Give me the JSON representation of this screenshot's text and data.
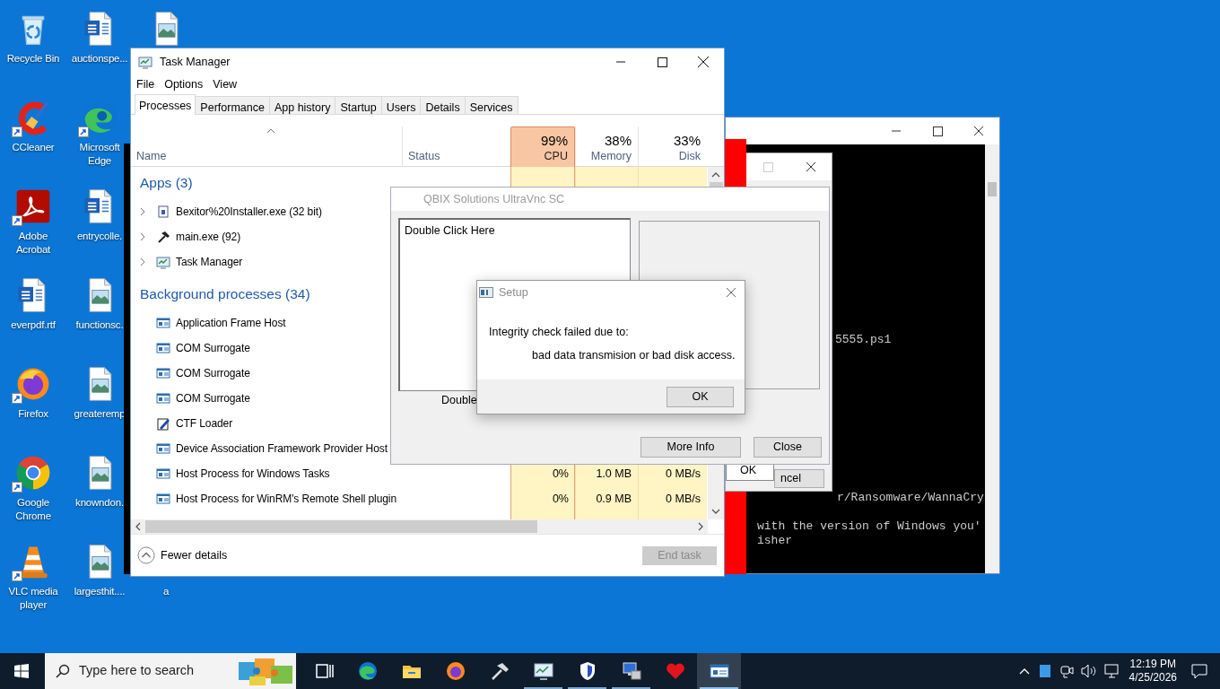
{
  "desktop_icons": [
    {
      "label": "Recycle Bin",
      "kind": "recycle",
      "shortcut": false
    },
    {
      "label": "CCleaner",
      "kind": "ccleaner",
      "shortcut": true
    },
    {
      "label": "Adobe Acrobat",
      "kind": "acrobat",
      "shortcut": true
    },
    {
      "label": "everpdf.rtf",
      "kind": "word",
      "shortcut": false
    },
    {
      "label": "Firefox",
      "kind": "firefox",
      "shortcut": true
    },
    {
      "label": "Google Chrome",
      "kind": "chrome",
      "shortcut": true
    },
    {
      "label": "VLC media player",
      "kind": "vlc",
      "shortcut": true
    },
    {
      "label": "auctionspe...",
      "kind": "word",
      "shortcut": false
    },
    {
      "label": "Microsoft Edge",
      "kind": "edge",
      "shortcut": true
    },
    {
      "label": "entrycolle.",
      "kind": "word",
      "shortcut": false
    },
    {
      "label": "functionsc.",
      "kind": "image",
      "shortcut": false
    },
    {
      "label": "greateremp",
      "kind": "image",
      "shortcut": false
    },
    {
      "label": "knowndon.",
      "kind": "image",
      "shortcut": false
    },
    {
      "label": "largesthit....",
      "kind": "image",
      "shortcut": false
    },
    {
      "kind": "image",
      "shortcut": false
    },
    {
      "label": "a"
    }
  ],
  "console": {
    "lines": [
      "5555.ps1",
      "r/Ransomware/WannaCry",
      "with the version of Windows you'",
      "isher"
    ]
  },
  "background_dialog": {
    "buttons": [
      "OK",
      "ncel"
    ]
  },
  "task_manager": {
    "title": "Task Manager",
    "menu": [
      "File",
      "Options",
      "View"
    ],
    "tabs": [
      {
        "label": "Processes",
        "selected": true
      },
      {
        "label": "Performance",
        "selected": false
      },
      {
        "label": "App history",
        "selected": false
      },
      {
        "label": "Startup",
        "selected": false
      },
      {
        "label": "Users",
        "selected": false
      },
      {
        "label": "Details",
        "selected": false
      },
      {
        "label": "Services",
        "selected": false
      }
    ],
    "columns": [
      {
        "label": "Name",
        "sorted": true,
        "highlighted": false
      },
      {
        "label": "Status",
        "sorted": false,
        "highlighted": false
      },
      {
        "label": "CPU",
        "total": "99%",
        "sorted": false,
        "highlighted": true
      },
      {
        "label": "Memory",
        "total": "38%",
        "sorted": false,
        "highlighted": false
      },
      {
        "label": "Disk",
        "total": "33%",
        "sorted": false,
        "highlighted": false
      }
    ],
    "groups": [
      {
        "title": "Apps (3)",
        "processes": [
          {
            "name": "Bexitor%20Installer.exe (32 bit)",
            "kind": "installer",
            "expandable": true
          },
          {
            "name": "main.exe (92)",
            "kind": "hammer",
            "expandable": true
          },
          {
            "name": "Task Manager",
            "kind": "monitor",
            "expandable": true
          }
        ]
      },
      {
        "title": "Background processes (34)",
        "processes": [
          {
            "name": "Application Frame Host",
            "kind": "window",
            "expandable": false
          },
          {
            "name": "COM Surrogate",
            "kind": "window",
            "expandable": false
          },
          {
            "name": "COM Surrogate",
            "kind": "window",
            "expandable": false
          },
          {
            "name": "COM Surrogate",
            "kind": "window",
            "expandable": false
          },
          {
            "name": "CTF Loader",
            "kind": "notepad",
            "expandable": false
          },
          {
            "name": "Device Association Framework Provider Host",
            "kind": "window",
            "expandable": false
          },
          {
            "name": "Host Process for Windows Tasks",
            "kind": "window",
            "expandable": false,
            "cpu": "0%",
            "memory": "1.0 MB",
            "disk": "0 MB/s"
          },
          {
            "name": "Host Process for WinRM's Remote Shell plugin",
            "kind": "window",
            "expandable": false,
            "cpu": "0%",
            "memory": "0.9 MB",
            "disk": "0 MB/s"
          }
        ]
      }
    ],
    "footer": {
      "toggle": "Fewer details",
      "end_task": {
        "label": "End task",
        "disabled": true
      }
    }
  },
  "qbix_window": {
    "title": "QBIX Solutions UltraVnc SC",
    "list_items": [
      "Double Click Here"
    ],
    "caption": "Double",
    "buttons": [
      "More Info",
      "Close"
    ]
  },
  "setup_dialog": {
    "title": "Setup",
    "lines": [
      "Integrity check failed due to:",
      "bad data transmision or bad disk access."
    ],
    "button": "OK"
  },
  "taskbar": {
    "search": {
      "placeholder": "Type here to search"
    },
    "apps": [
      {
        "kind": "taskview",
        "running": false,
        "active": false
      },
      {
        "kind": "edge",
        "running": false,
        "active": false
      },
      {
        "kind": "folder",
        "running": false,
        "active": false
      },
      {
        "kind": "firefox",
        "running": false,
        "active": false
      },
      {
        "kind": "hammer",
        "running": false,
        "active": false
      },
      {
        "kind": "monitor",
        "running": true,
        "active": false
      },
      {
        "kind": "shield",
        "running": true,
        "active": false
      },
      {
        "kind": "computer",
        "running": true,
        "active": false
      },
      {
        "kind": "heart",
        "running": false,
        "active": false
      },
      {
        "kind": "window",
        "running": true,
        "active": true
      }
    ],
    "clock": {
      "time": "12:19 PM",
      "date": "4/25/2026"
    }
  }
}
